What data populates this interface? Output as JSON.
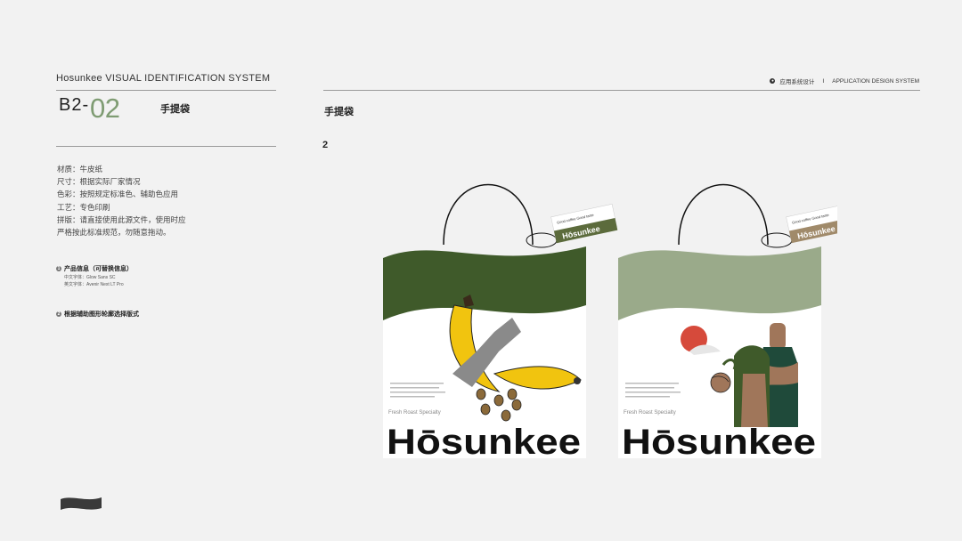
{
  "header": {
    "doc_title": "Hosunkee VISUAL IDENTIFICATION SYSTEM",
    "section_icon": "circle-number-icon",
    "section_label": "应用系统设计",
    "divider": "I",
    "system_label": "APPLICATION DESIGN SYSTEM"
  },
  "page": {
    "code_prefix": "B2-",
    "code_number": "02",
    "item_title": "手提袋",
    "step_number": "2"
  },
  "specs": [
    "材质：牛皮纸",
    "尺寸：根据实际厂家情况",
    "色彩：按照规定标准色、辅助色应用",
    "工艺：专色印刷",
    "拼版：请直接使用此源文件，使用时应",
    "严格按此标准规范，勿随意拖动。"
  ],
  "notes": [
    {
      "title": "产品信息（可替换信息）",
      "sub": [
        "中文字体：Glow Sans SC",
        "英文字体：Avenir Next LT Pro"
      ]
    },
    {
      "title": "根据辅助图形轮廓选择版式",
      "sub": []
    }
  ],
  "bags": [
    {
      "brand": "Hōsunkee",
      "tagline": "Fresh Roast Specialty",
      "tag_brand": "Hōsunkee",
      "tag_text": "Good coffee Good taste",
      "wave_color": "#3f5a2a",
      "tag_color": "#5c6b3c",
      "illustration": "banana-coffee-beans"
    },
    {
      "brand": "Hōsunkee",
      "tagline": "Fresh Roast Specialty",
      "tag_brand": "Hōsunkee",
      "tag_text": "Good coffee Good taste",
      "wave_color": "#9aaa8a",
      "tag_color": "#a08a6a",
      "illustration": "bottle-trees-sun"
    }
  ],
  "colors": {
    "accent_green": "#7f9c73",
    "dark_green": "#3f5a2a",
    "sage": "#9aaa8a",
    "banana_yellow": "#f1c40f",
    "sun_red": "#d64a3b",
    "bottle_brown": "#a0765a",
    "forest": "#1f4a3a",
    "ribbon_grey": "#8a8a8a"
  }
}
